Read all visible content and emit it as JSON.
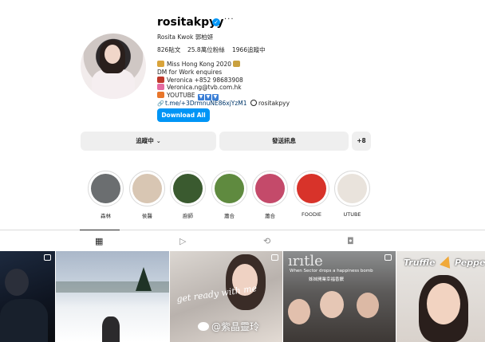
{
  "profile": {
    "username": "rositakpyy",
    "full_name": "Rosita Kwok 郭柏妍",
    "stats": {
      "posts": "826貼文",
      "followers": "25.8萬位粉絲",
      "following": "1966追蹤中"
    },
    "bio": [
      "Miss Hong Kong 2020",
      "DM for Work enquires",
      "Veronica +852 98683908",
      "Veronica.ng@tvb.com.hk",
      "YOUTUBE"
    ],
    "link": "t.me/+3DrmnuNE86xjYzM1",
    "threads": "rositakpyy",
    "download_label": "Download All"
  },
  "actions": {
    "following": "追蹤中",
    "message": "發送訊息",
    "add_user": "+8"
  },
  "highlights": [
    {
      "label": "森林",
      "color": "#6b6e70"
    },
    {
      "label": "侯醫",
      "color": "#d8c6b3"
    },
    {
      "label": "廚師",
      "color": "#3a5a2f"
    },
    {
      "label": "蕭合",
      "color": "#5f8a3f"
    },
    {
      "label": "蕭合",
      "color": "#c44a6a"
    },
    {
      "label": "FOODIE",
      "color": "#d8332a"
    },
    {
      "label": "UTUBE",
      "color": "#e9e3dc"
    }
  ],
  "grid_captions": {
    "gwr": "get ready with me",
    "sister": "When Sector drops a happiness bomb",
    "sister_sub": "姊妹開業幸福香饌",
    "truffle": "Truffle",
    "pepper": "Peppe"
  },
  "watermark": "@紫晶靈玲"
}
